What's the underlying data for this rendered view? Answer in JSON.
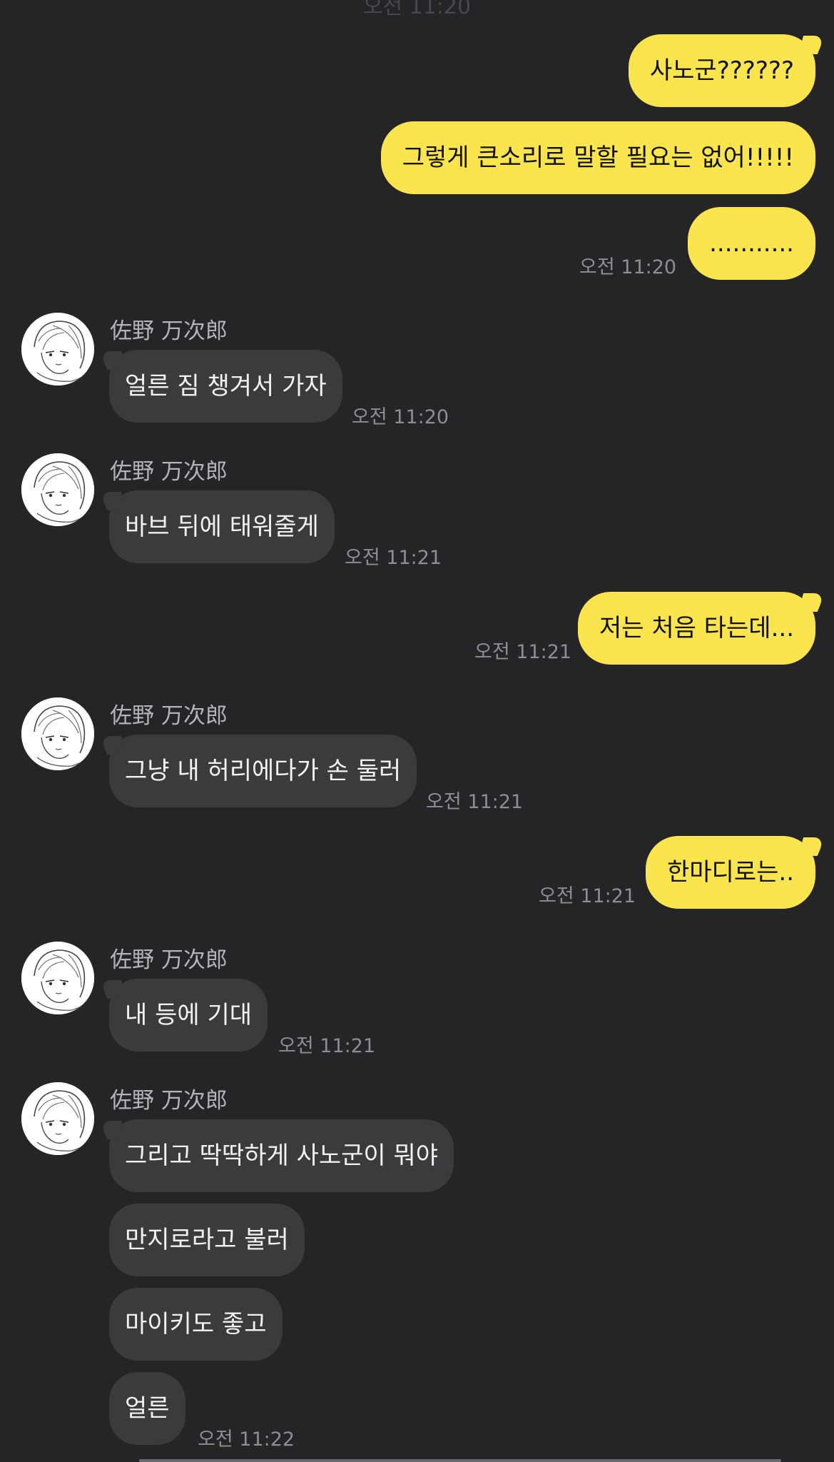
{
  "header": {
    "time_partial": "오전 11:20"
  },
  "contact": {
    "name": "佐野 万次郎",
    "avatar_icon": "avatar-illustration-icon"
  },
  "colors": {
    "background": "#252528",
    "outgoing_bubble": "#fbe54f",
    "incoming_bubble": "#3b3b3e",
    "timestamp": "#8e8e92"
  },
  "messages": [
    {
      "side": "out",
      "text": "사노군??????"
    },
    {
      "side": "out",
      "text": "그렇게 큰소리로 말할 필요는 없어!!!!!"
    },
    {
      "side": "out",
      "text": "...........",
      "time": "오전 11:20"
    },
    {
      "side": "in",
      "sender": "佐野 万次郎",
      "text": "얼른 짐 챙겨서 가자",
      "time": "오전 11:20"
    },
    {
      "side": "in",
      "sender": "佐野 万次郎",
      "text": "바브 뒤에 태워줄게",
      "time": "오전 11:21"
    },
    {
      "side": "out",
      "text": "저는 처음 타는데...",
      "time": "오전 11:21"
    },
    {
      "side": "in",
      "sender": "佐野 万次郎",
      "text": "그냥 내 허리에다가 손 둘러",
      "time": "오전 11:21"
    },
    {
      "side": "out",
      "text": "한마디로는..",
      "time": "오전 11:21"
    },
    {
      "side": "in",
      "sender": "佐野 万次郎",
      "text": "내 등에 기대",
      "time": "오전 11:21"
    },
    {
      "side": "in",
      "sender": "佐野 万次郎",
      "text": "그리고 딱딱하게 사노군이 뭐야"
    },
    {
      "side": "in",
      "text": "만지로라고 불러"
    },
    {
      "side": "in",
      "text": "마이키도 좋고"
    },
    {
      "side": "in",
      "text": "얼른",
      "time": "오전 11:22"
    }
  ]
}
